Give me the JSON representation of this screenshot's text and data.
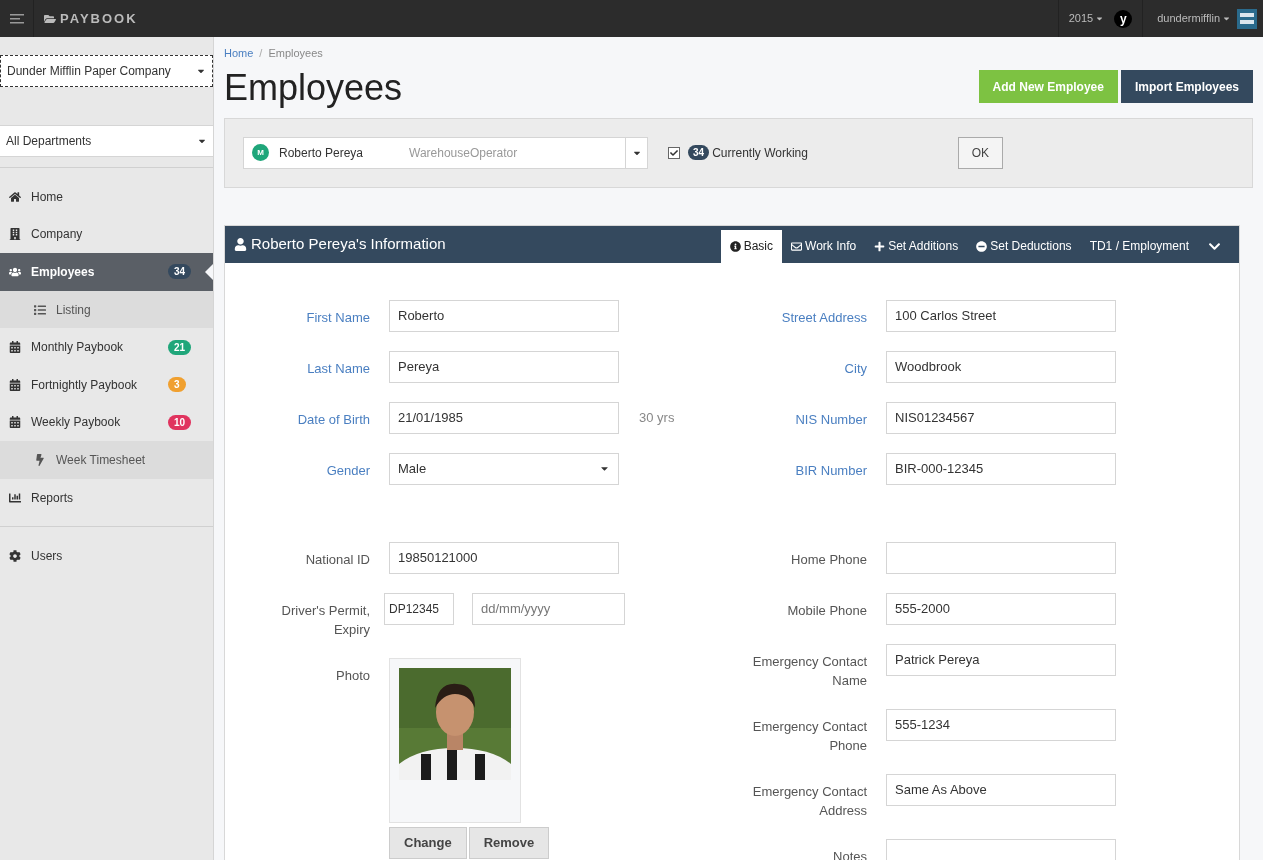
{
  "topbar": {
    "brand": "PAYBOOK",
    "year": "2015",
    "avatar_letter": "y",
    "user": "dundermifflin"
  },
  "sidebar": {
    "company": "Dunder Mifflin Paper Company",
    "department": "All Departments",
    "items": [
      {
        "label": "Home",
        "selected": false,
        "sub": false
      },
      {
        "label": "Company",
        "selected": false,
        "sub": false
      },
      {
        "label": "Employees",
        "selected": true,
        "sub": false,
        "badge": "34",
        "color": "#34495e"
      },
      {
        "label": "Listing",
        "selected": false,
        "sub": true
      },
      {
        "label": "Monthly Paybook",
        "selected": false,
        "sub": false,
        "badge": "21",
        "color": "#1fa67a"
      },
      {
        "label": "Fortnightly Paybook",
        "selected": false,
        "sub": false,
        "badge": "3",
        "color": "#f0a030"
      },
      {
        "label": "Weekly Paybook",
        "selected": false,
        "sub": false,
        "badge": "10",
        "color": "#e0335e"
      },
      {
        "label": "Week Timesheet",
        "selected": false,
        "sub": true
      },
      {
        "label": "Reports",
        "selected": false,
        "sub": false
      },
      {
        "label": "Users",
        "selected": false,
        "sub": false
      }
    ]
  },
  "breadcrumb": {
    "items": [
      "Home",
      "Employees"
    ],
    "separator": "/"
  },
  "title": "Employees",
  "actions": [
    {
      "label": "Add New Employee",
      "kind": "primary"
    },
    {
      "label": "Import Employees",
      "kind": "dark"
    }
  ],
  "filter": {
    "initial": "M",
    "name": "Roberto Pereya",
    "role": "WarehouseOperator",
    "currently_working": true,
    "count": "34",
    "label": "Currently Working",
    "ok": "OK"
  },
  "panel": {
    "title": "Roberto Pereya's Information",
    "tabs": [
      {
        "label": "Basic",
        "selected": true
      },
      {
        "label": "Work Info",
        "selected": false
      },
      {
        "label": "Set Additions",
        "selected": false
      },
      {
        "label": "Set Deductions",
        "selected": false
      },
      {
        "label": "TD1 / Employment",
        "selected": false
      }
    ]
  },
  "form": {
    "top": {
      "left": [
        {
          "label": "First Name",
          "required": true,
          "kind": "text",
          "value": "Roberto"
        },
        {
          "label": "Last Name",
          "required": true,
          "kind": "text",
          "value": "Pereya"
        },
        {
          "label": "Date of Birth",
          "required": true,
          "kind": "text",
          "value": "21/01/1985",
          "note": "30 yrs"
        },
        {
          "label": "Gender",
          "required": true,
          "kind": "select",
          "value": "Male"
        }
      ],
      "right": [
        {
          "label": "Street Address",
          "required": true,
          "kind": "text",
          "value": "100 Carlos Street"
        },
        {
          "label": "City",
          "required": true,
          "kind": "text",
          "value": "Woodbrook"
        },
        {
          "label": "NIS Number",
          "required": true,
          "kind": "text",
          "value": "NIS01234567"
        },
        {
          "label": "BIR Number",
          "required": true,
          "kind": "text",
          "value": "BIR-000-12345"
        }
      ]
    },
    "bottom": {
      "left": [
        {
          "label": "National ID",
          "required": false,
          "kind": "text",
          "value": "19850121000"
        },
        {
          "label": "Driver's Permit, Expiry",
          "required": false,
          "kind": "pair",
          "value": "DP12345",
          "placeholder": "dd/mm/yyyy"
        },
        {
          "label": "Photo",
          "required": false,
          "buttons": [
            "Change",
            "Remove"
          ]
        }
      ],
      "right": [
        {
          "label": "Home Phone",
          "required": false,
          "kind": "text"
        },
        {
          "label": "Mobile Phone",
          "required": false,
          "kind": "text",
          "value": "555-2000"
        },
        {
          "label": "Emergency Contact Name",
          "required": false,
          "kind": "text",
          "value": "Patrick Pereya"
        },
        {
          "label": "Emergency Contact Phone",
          "required": false,
          "kind": "text",
          "value": "555-1234"
        },
        {
          "label": "Emergency Contact Address",
          "required": false,
          "kind": "text",
          "value": "Same As Above"
        },
        {
          "label": "Notes",
          "required": false,
          "kind": "text"
        }
      ]
    }
  }
}
